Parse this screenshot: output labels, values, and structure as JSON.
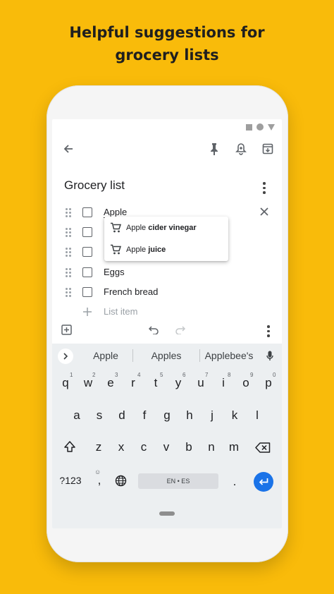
{
  "headline": {
    "line1": "Helpful suggestions for",
    "line2": "grocery lists"
  },
  "status_bar": {
    "icons": [
      "square-icon",
      "circle-icon",
      "triangle-icon"
    ]
  },
  "toolbar": {
    "icons": [
      "back-arrow-icon",
      "pin-icon",
      "reminder-bell-icon",
      "archive-icon"
    ]
  },
  "note": {
    "title": "Grocery list",
    "items": [
      {
        "text": "Apple",
        "checked": false,
        "editing": true
      },
      {
        "text": "",
        "checked": false
      },
      {
        "text": "",
        "checked": false
      },
      {
        "text": "Eggs",
        "checked": false
      },
      {
        "text": "French bread",
        "checked": false
      }
    ],
    "add_placeholder": "List item"
  },
  "autocomplete": [
    {
      "prefix": "Apple ",
      "bold": "cider vinegar",
      "icon": "cart-icon"
    },
    {
      "prefix": "Apple ",
      "bold": "juice",
      "icon": "cart-icon"
    }
  ],
  "bottom_toolbar": {
    "icons": [
      "add-box-icon",
      "undo-icon",
      "redo-icon",
      "more-icon"
    ]
  },
  "keyboard": {
    "suggestions": [
      "Apple",
      "Apples",
      "Applebee's"
    ],
    "row1": [
      "q",
      "w",
      "e",
      "r",
      "t",
      "y",
      "u",
      "i",
      "o",
      "p"
    ],
    "row1_hints": [
      "1",
      "2",
      "3",
      "4",
      "5",
      "6",
      "7",
      "8",
      "9",
      "0"
    ],
    "row2": [
      "a",
      "s",
      "d",
      "f",
      "g",
      "h",
      "j",
      "k",
      "l"
    ],
    "row3": [
      "z",
      "x",
      "c",
      "v",
      "b",
      "n",
      "m"
    ],
    "symbols_key": "?123",
    "comma_key": ",",
    "period_key": ".",
    "space_label": "EN • ES",
    "accent_color": "#1a73e8"
  },
  "colors": {
    "background": "#F9BB0A",
    "screen": "#ffffff",
    "keyboard": "#eceff1"
  }
}
